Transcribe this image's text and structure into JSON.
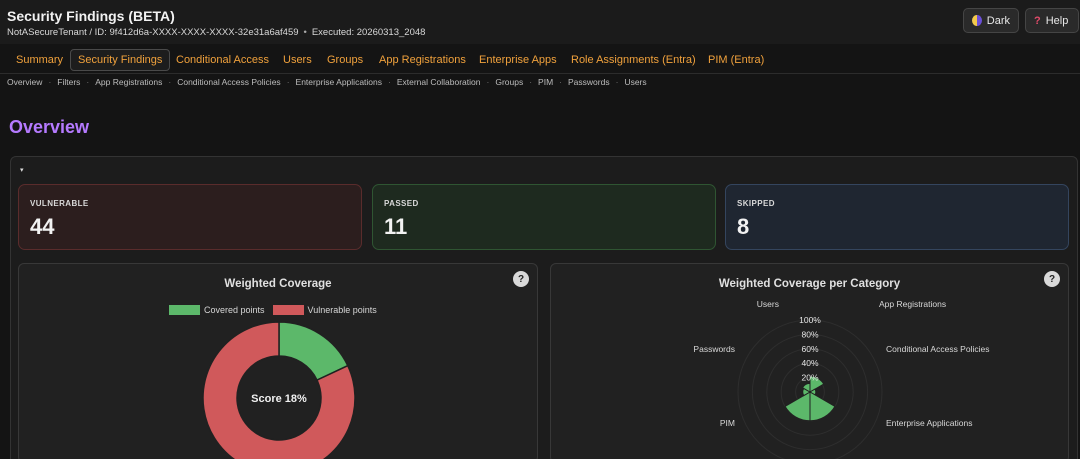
{
  "header": {
    "title": "Security Findings (BETA)",
    "tenant_line": "NotASecureTenant / ID: 9f412d6a-XXXX-XXXX-XXXX-32e31a6af459",
    "executed": "Executed: 20260313_2048",
    "separator": "•",
    "theme_label": "Dark",
    "help_label": "Help"
  },
  "tabs": [
    {
      "label": "Summary"
    },
    {
      "label": "Security Findings"
    },
    {
      "label": "Conditional Access"
    },
    {
      "label": "Users"
    },
    {
      "label": "Groups"
    },
    {
      "label": "App Registrations"
    },
    {
      "label": "Enterprise Apps"
    },
    {
      "label": "Role Assignments (Entra)"
    },
    {
      "label": "PIM (Entra)"
    }
  ],
  "active_tab": "Security Findings",
  "subnav": [
    "Overview",
    "Filters",
    "App Registrations",
    "Conditional Access Policies",
    "Enterprise Applications",
    "External Collaboration",
    "Groups",
    "PIM",
    "Passwords",
    "Users"
  ],
  "page_title": "Overview",
  "stats": {
    "vulnerable": {
      "label": "VULNERABLE",
      "value": "44"
    },
    "passed": {
      "label": "PASSED",
      "value": "11"
    },
    "skipped": {
      "label": "SKIPPED",
      "value": "8"
    }
  },
  "colors": {
    "covered": "#5cb86a",
    "vulnerable": "#d0595b",
    "accent_tab": "#f0a13c",
    "title": "#b57aff"
  },
  "chart_data": [
    {
      "type": "pie",
      "title": "Weighted Coverage",
      "legend": [
        "Covered points",
        "Vulnerable points"
      ],
      "values": [
        18,
        82
      ],
      "center_label": "Score 18%",
      "legend_position": "top"
    },
    {
      "type": "radar",
      "title": "Weighted Coverage per Category",
      "categories": [
        "App Registrations",
        "Conditional Access Policies",
        "Enterprise Applications",
        "PIM",
        "Passwords",
        "Users"
      ],
      "values": [
        22,
        8,
        40,
        40,
        10,
        12
      ],
      "ticks": [
        "20%",
        "40%",
        "60%",
        "80%",
        "100%"
      ],
      "range": [
        0,
        100
      ]
    }
  ],
  "info_label": "?",
  "caret": "▾"
}
